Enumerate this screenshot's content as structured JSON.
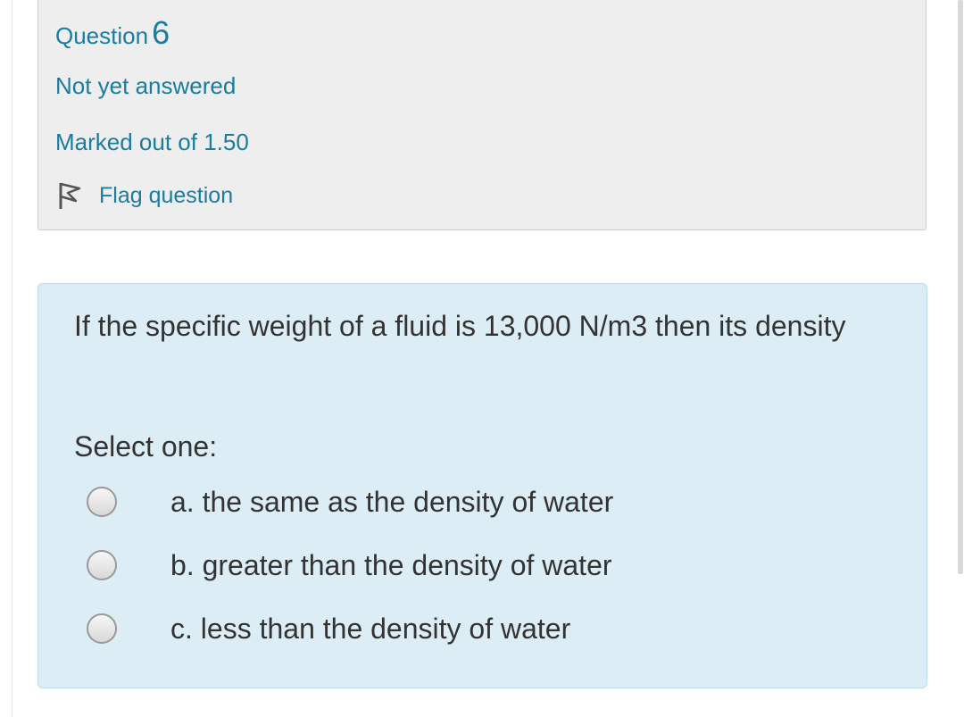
{
  "question": {
    "title_prefix": "Question",
    "number": "6",
    "state": "Not yet answered",
    "grade": "Marked out of 1.50",
    "flag_label": "Flag question",
    "flag_icon": "flag-icon"
  },
  "content": {
    "text": "If the specific weight of a fluid is 13,000 N/m3 then its density",
    "prompt": "Select one:",
    "answers": [
      {
        "label": "a. the same as the density of water",
        "selected": false
      },
      {
        "label": "b. greater than the density of water",
        "selected": false
      },
      {
        "label": "c. less than the density of water",
        "selected": false
      }
    ]
  },
  "colors": {
    "link": "#1a7c9f",
    "info_background": "#eeeeee",
    "content_background": "#dcedf5",
    "text": "#333333"
  }
}
